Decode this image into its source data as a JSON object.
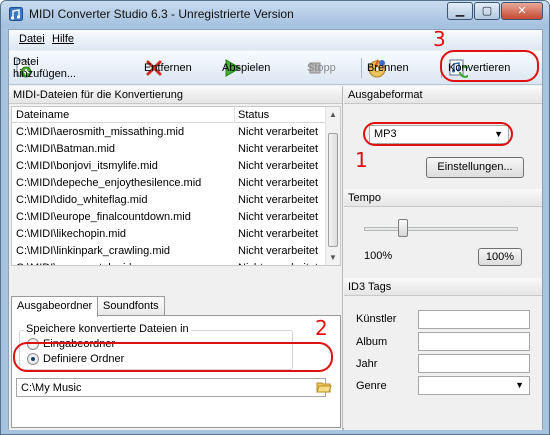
{
  "window": {
    "title": "MIDI Converter Studio 6.3 - Unregistrierte Version",
    "buttons": [
      "minimize",
      "maximize",
      "close"
    ]
  },
  "menu": {
    "items": [
      "Datei",
      "Hilfe"
    ]
  },
  "toolbar": {
    "add_label": "Datei hinzufügen...",
    "remove_label": "Entfernen",
    "play_label": "Abspielen",
    "stop_label": "Stopp",
    "burn_label": "Brennen",
    "convert_label": "Konvertieren",
    "icons": {
      "add": "add-file-icon",
      "remove": "remove-icon",
      "play": "play-icon",
      "stop": "stop-icon",
      "burn": "burn-cd-icon",
      "convert": "convert-icon"
    }
  },
  "files_panel": {
    "title": "MIDI-Dateien für die Konvertierung",
    "columns": [
      "Dateiname",
      "Status"
    ],
    "rows": [
      [
        "C:\\MIDI\\aerosmith_missathing.mid",
        "Nicht verarbeitet"
      ],
      [
        "C:\\MIDI\\Batman.mid",
        "Nicht verarbeitet"
      ],
      [
        "C:\\MIDI\\bonjovi_itsmylife.mid",
        "Nicht verarbeitet"
      ],
      [
        "C:\\MIDI\\depeche_enjoythesilence.mid",
        "Nicht verarbeitet"
      ],
      [
        "C:\\MIDI\\dido_whiteflag.mid",
        "Nicht verarbeitet"
      ],
      [
        "C:\\MIDI\\europe_finalcountdown.mid",
        "Nicht verarbeitet"
      ],
      [
        "C:\\MIDI\\likechopin.mid",
        "Nicht verarbeitet"
      ],
      [
        "C:\\MIDI\\linkinpark_crawling.mid",
        "Nicht verarbeitet"
      ],
      [
        "C:\\MIDI\\mymmortal.mid",
        "Nicht verarbeitet"
      ]
    ]
  },
  "output_tabs": {
    "tabs": [
      "Ausgabeordner",
      "Soundfonts"
    ],
    "active": "Ausgabeordner",
    "group_label": "Speichere konvertierte Dateien in",
    "radio_input_folder": "Eingabeordner",
    "radio_defined_folder": "Definiere Ordner",
    "selected_radio": "Definiere Ordner",
    "folder_path": "C:\\My Music"
  },
  "output_format": {
    "title": "Ausgabeformat",
    "selected": "MP3",
    "settings_button": "Einstellungen..."
  },
  "tempo": {
    "title": "Tempo",
    "value_label": "100%",
    "reset_button": "100%",
    "slider_fraction": 0.25
  },
  "id3": {
    "title": "ID3 Tags",
    "fields": [
      "Künstler",
      "Album",
      "Jahr",
      "Genre"
    ]
  },
  "annotations": {
    "color": "#e01010",
    "numbers": [
      "1",
      "2",
      "3"
    ]
  }
}
